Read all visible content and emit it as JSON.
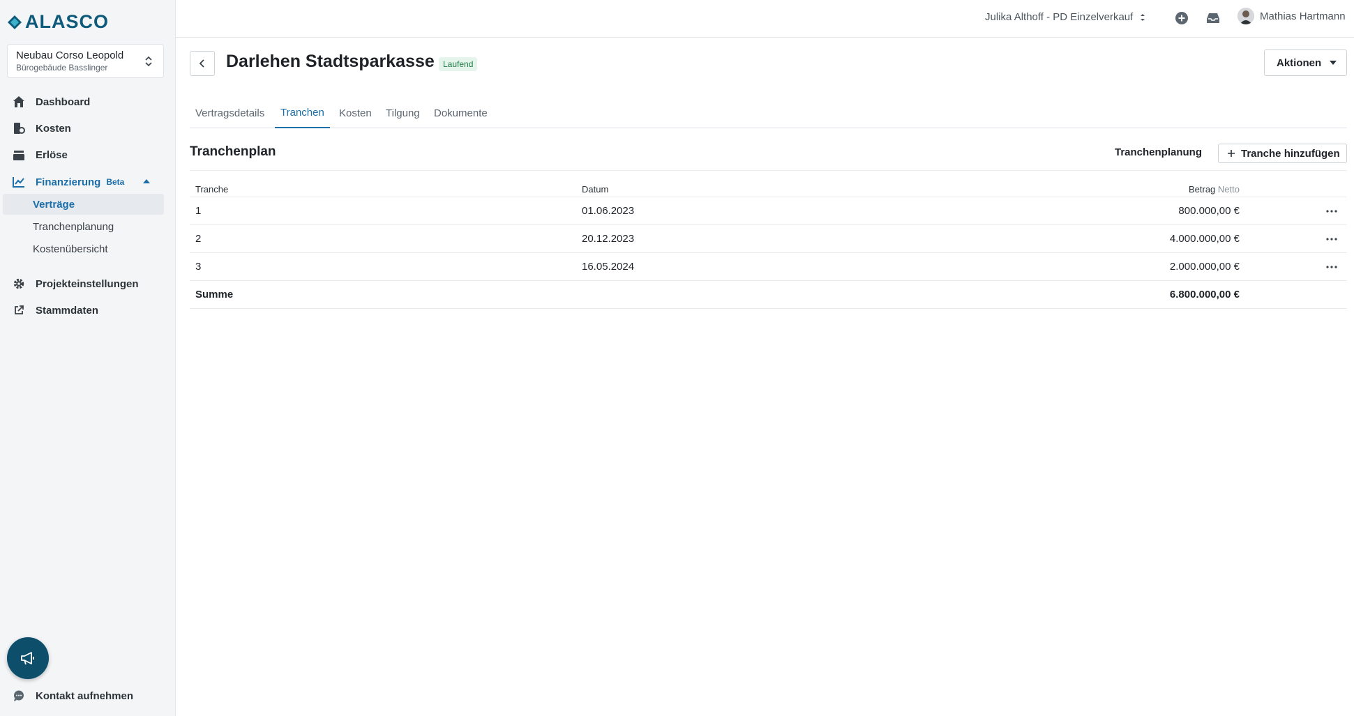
{
  "brand": {
    "logo_text": "ALASCO",
    "accent": "#1b6ea8",
    "brand_dark": "#0d4f6b"
  },
  "project": {
    "name": "Neubau Corso Leopold",
    "subtitle": "Bürogebäude Basslinger"
  },
  "sidebar": {
    "items": [
      {
        "label": "Dashboard",
        "icon": "home-icon"
      },
      {
        "label": "Kosten",
        "icon": "cost-icon"
      },
      {
        "label": "Erlöse",
        "icon": "revenue-icon"
      },
      {
        "label": "Finanzierung",
        "icon": "financing-icon",
        "badge": "Beta",
        "expanded": true
      },
      {
        "label": "Projekteinstellungen",
        "icon": "gear-icon"
      },
      {
        "label": "Stammdaten",
        "icon": "external-link-icon"
      }
    ],
    "subitems": [
      {
        "label": "Verträge",
        "selected": true
      },
      {
        "label": "Tranchenplanung"
      },
      {
        "label": "Kostenübersicht"
      }
    ],
    "contact_label": "Kontakt aufnehmen"
  },
  "topbar": {
    "org": "Julika Althoff - PD Einzelverkauf",
    "user": "Mathias Hartmann"
  },
  "header": {
    "title": "Darlehen Stadtsparkasse",
    "status": "Laufend",
    "actions_label": "Aktionen"
  },
  "tabs": [
    {
      "label": "Vertragsdetails"
    },
    {
      "label": "Tranchen",
      "active": true
    },
    {
      "label": "Kosten"
    },
    {
      "label": "Tilgung"
    },
    {
      "label": "Dokumente"
    }
  ],
  "section": {
    "title": "Tranchenplan",
    "planning_link": "Tranchenplanung",
    "add_label": "Tranche hinzufügen"
  },
  "table": {
    "headers": {
      "tranche": "Tranche",
      "datum": "Datum",
      "betrag": "Betrag",
      "betrag_suffix": "Netto"
    },
    "rows": [
      {
        "tranche": "1",
        "datum": "01.06.2023",
        "betrag": "800.000,00 €"
      },
      {
        "tranche": "2",
        "datum": "20.12.2023",
        "betrag": "4.000.000,00 €"
      },
      {
        "tranche": "3",
        "datum": "16.05.2024",
        "betrag": "2.000.000,00 €"
      }
    ],
    "sum": {
      "label": "Summe",
      "betrag": "6.800.000,00 €"
    }
  }
}
